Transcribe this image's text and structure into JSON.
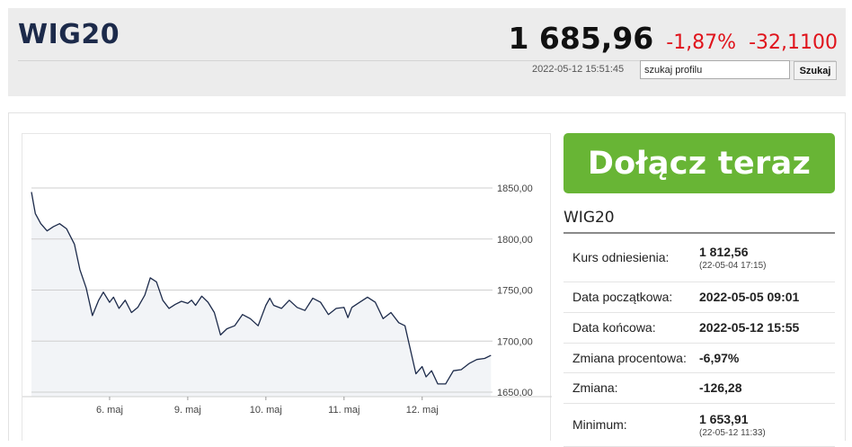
{
  "header": {
    "ticker": "WIG20",
    "price": "1 685,96",
    "change_pct": "-1,87%",
    "change_abs": "-32,1100",
    "timestamp": "2022-05-12 15:51:45",
    "search_value": "szukaj profilu",
    "search_button": "Szukaj"
  },
  "cta": {
    "label": "Dołącz teraz"
  },
  "info": {
    "title": "WIG20",
    "rows": [
      {
        "key": "Kurs odniesienia:",
        "value": "1 812,56",
        "sub": "(22-05-04 17:15)"
      },
      {
        "key": "Data początkowa:",
        "value": "2022-05-05 09:01",
        "sub": ""
      },
      {
        "key": "Data końcowa:",
        "value": "2022-05-12 15:55",
        "sub": ""
      },
      {
        "key": "Zmiana procentowa:",
        "value": "-6,97%",
        "sub": ""
      },
      {
        "key": "Zmiana:",
        "value": "-126,28",
        "sub": ""
      },
      {
        "key": "Minimum:",
        "value": "1 653,91",
        "sub": "(22-05-12 11:33)"
      }
    ]
  },
  "chart_data": {
    "type": "line",
    "ylim": [
      1640,
      1880
    ],
    "y_ticks": [
      "1850,00",
      "1800,00",
      "1750,00",
      "1700,00",
      "1650,00"
    ],
    "y_tick_values": [
      1850,
      1800,
      1750,
      1700,
      1650
    ],
    "x_ticks": [
      "6. maj",
      "9. maj",
      "10. maj",
      "11. maj",
      "12. maj"
    ],
    "x_tick_positions": [
      1,
      2,
      3,
      4,
      5
    ],
    "x_domain": [
      0,
      5.9
    ],
    "line_color": "#1c2a4a",
    "area_color": "#f2f4f7",
    "x": [
      0.0,
      0.05,
      0.12,
      0.2,
      0.28,
      0.36,
      0.45,
      0.55,
      0.62,
      0.7,
      0.78,
      0.86,
      0.92,
      1.0,
      1.05,
      1.12,
      1.2,
      1.28,
      1.36,
      1.45,
      1.52,
      1.6,
      1.68,
      1.76,
      1.84,
      1.92,
      2.0,
      2.05,
      2.1,
      2.18,
      2.26,
      2.34,
      2.42,
      2.5,
      2.6,
      2.7,
      2.8,
      2.9,
      3.0,
      3.05,
      3.1,
      3.2,
      3.3,
      3.4,
      3.5,
      3.6,
      3.7,
      3.8,
      3.9,
      4.0,
      4.05,
      4.1,
      4.2,
      4.3,
      4.4,
      4.5,
      4.6,
      4.7,
      4.78,
      4.86,
      4.92,
      5.0,
      5.05,
      5.12,
      5.2,
      5.3,
      5.4,
      5.5,
      5.6,
      5.7,
      5.8,
      5.88
    ],
    "values": [
      1846,
      1825,
      1815,
      1808,
      1812,
      1815,
      1810,
      1795,
      1770,
      1752,
      1725,
      1740,
      1748,
      1738,
      1743,
      1732,
      1740,
      1728,
      1733,
      1745,
      1762,
      1758,
      1740,
      1732,
      1736,
      1739,
      1737,
      1740,
      1735,
      1744,
      1738,
      1728,
      1706,
      1712,
      1715,
      1726,
      1722,
      1715,
      1735,
      1742,
      1735,
      1732,
      1740,
      1733,
      1730,
      1742,
      1738,
      1726,
      1732,
      1733,
      1723,
      1733,
      1738,
      1743,
      1738,
      1722,
      1728,
      1718,
      1715,
      1688,
      1668,
      1675,
      1665,
      1671,
      1658,
      1658,
      1671,
      1672,
      1678,
      1682,
      1683,
      1686
    ]
  }
}
